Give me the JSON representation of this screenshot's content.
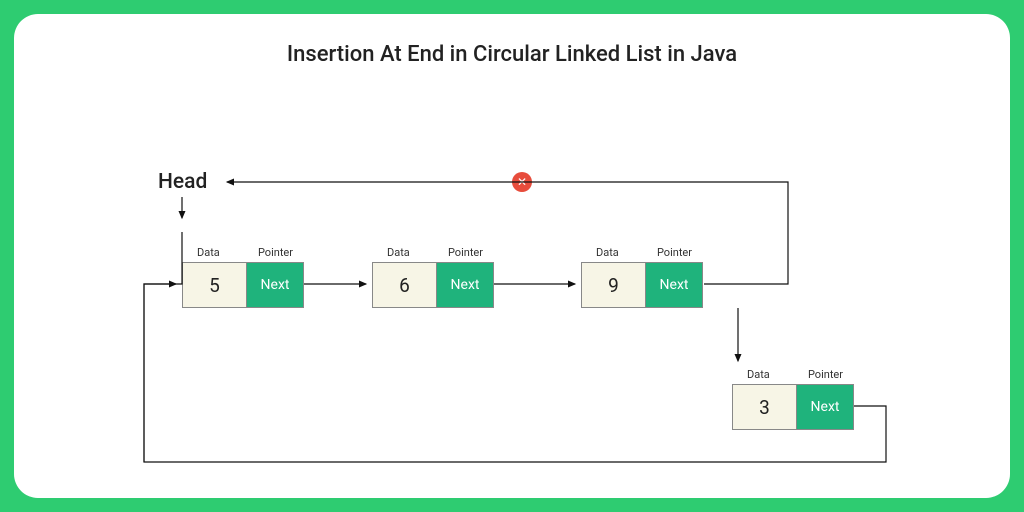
{
  "title": "Insertion At End in Circular Linked List in Java",
  "head_label": "Head",
  "labels": {
    "data": "Data",
    "pointer": "Pointer",
    "next": "Next"
  },
  "nodes": [
    {
      "value": "5"
    },
    {
      "value": "6"
    },
    {
      "value": "9"
    },
    {
      "value": "3"
    }
  ],
  "badge_icon": "✕",
  "colors": {
    "frame": "#2ecc71",
    "pointer_fill": "#1fb37c",
    "data_fill": "#f7f5e6",
    "badge": "#e74c3c"
  }
}
